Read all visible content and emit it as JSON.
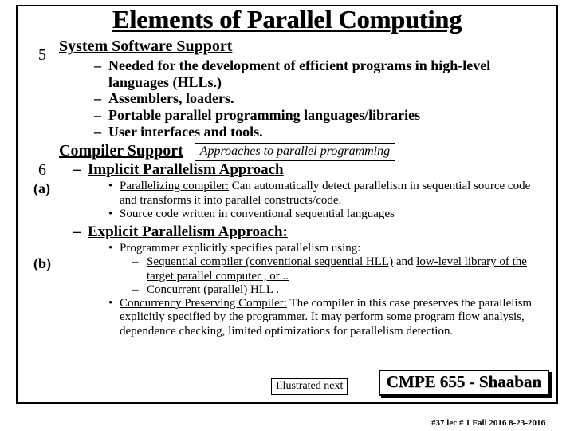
{
  "title": "Elements of Parallel Computing",
  "num5": "5",
  "num6": "6",
  "labA": "(a)",
  "labB": "(b)",
  "sec5": {
    "heading": "System Software Support",
    "b1": "Needed for the development of efficient programs in high-level languages (HLLs.)",
    "b2": "Assemblers, loaders.",
    "b3": "Portable parallel programming languages/libraries",
    "b4": "User interfaces and tools."
  },
  "sec6": {
    "heading": "Compiler Support",
    "approaches": "Approaches to parallel programming",
    "implicit": "Implicit Parallelism Approach",
    "impB1a": "Parallelizing compiler:",
    "impB1b": "  Can automatically detect parallelism in sequential source code and transforms it into parallel constructs/code.",
    "impB2": "Source code written in conventional sequential languages",
    "explicit": "Explicit Parallelism Approach:",
    "expB1": "Programmer explicitly specifies parallelism using:",
    "expS1a": "Sequential compiler (conventional sequential HLL)",
    "expS1b": "  and ",
    "expS1c": "low-level library of the target parallel computer , or ..",
    "expS2": "Concurrent (parallel) HLL .",
    "expB2a": "Concurrency Preserving Compiler:",
    "expB2b": " The compiler in this case preserves the parallelism explicitly specified by the programmer.  It may perform some program flow analysis, dependence checking, limited optimizations for parallelism detection."
  },
  "illus": "Illustrated next",
  "course": "CMPE 655 - Shaaban",
  "footer": "#37  lec # 1   Fall 2016   8-23-2016"
}
